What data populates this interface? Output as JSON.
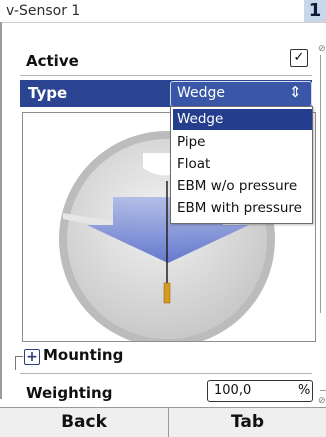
{
  "header": {
    "title": "v-Sensor 1",
    "page_number": "1"
  },
  "active": {
    "label": "Active",
    "checked": true,
    "check_glyph": "✓"
  },
  "type": {
    "label": "Type",
    "value": "Wedge",
    "spinner_glyph": "⇕",
    "options": [
      "Wedge",
      "Pipe",
      "Float",
      "EBM w/o pressure",
      "EBM with pressure"
    ],
    "selected_index": 0
  },
  "mounting": {
    "label": "Mounting",
    "expand_glyph": "+"
  },
  "weighting": {
    "label": "Weighting",
    "value": "100,0",
    "unit": "%"
  },
  "buttons": {
    "back": "Back",
    "tab": "Tab"
  },
  "colors": {
    "accent": "#2b4592",
    "selected": "#243d8c",
    "title_highlight": "#c9d7ea"
  },
  "icons": [
    "checkbox-check-icon",
    "spinner-icon",
    "plus-icon",
    "wedge-sensor-illustration"
  ]
}
